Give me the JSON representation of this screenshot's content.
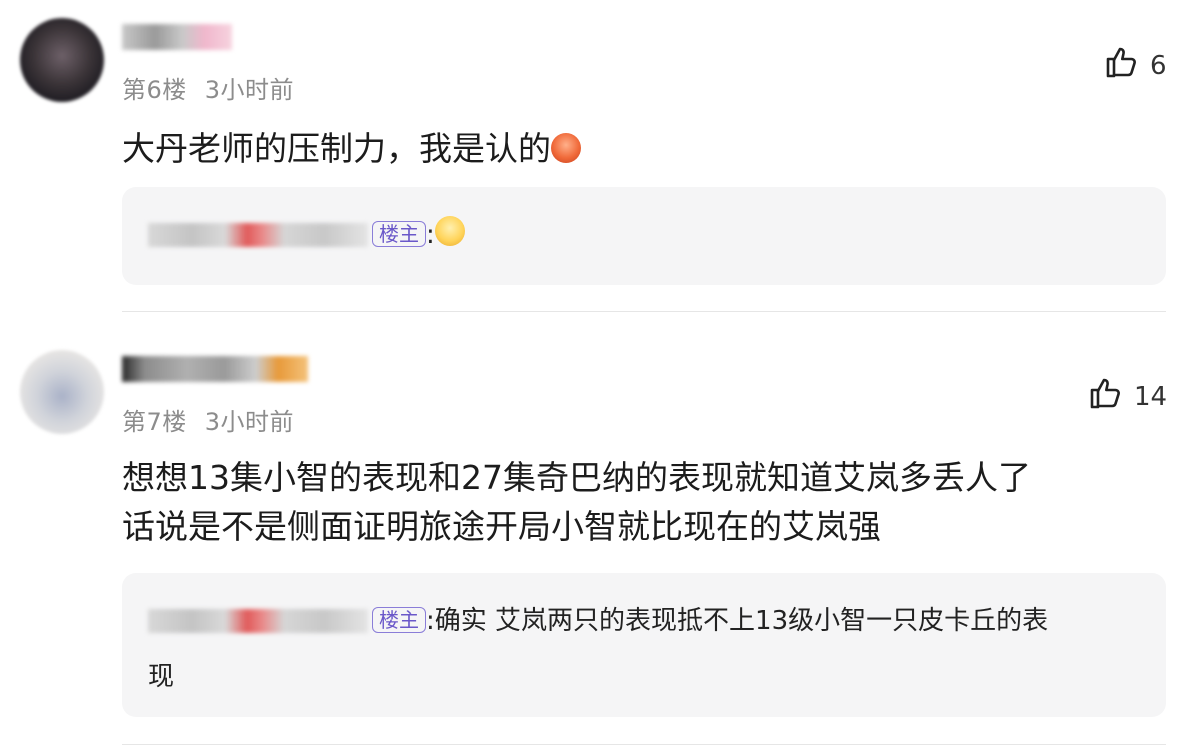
{
  "comments": [
    {
      "floor": "第6楼",
      "time": "3小时前",
      "likes": "6",
      "text": "大丹老师的压制力，我是认的",
      "emoji": "angry-face-emoji",
      "reply": {
        "host_badge": "楼主",
        "separator": ":",
        "text": "",
        "emoji": "smile-face-emoji"
      }
    },
    {
      "floor": "第7楼",
      "time": "3小时前",
      "likes": "14",
      "text_line1": "想想13集小智的表现和27集奇巴纳的表现就知道艾岚多丢人了",
      "text_line2": "话说是不是侧面证明旅途开局小智就比现在的艾岚强",
      "reply": {
        "host_badge": "楼主",
        "separator": ":",
        "text_line1": "确实 艾岚两只的表现抵不上13级小智一只皮卡丘的表",
        "text_line2": "现"
      }
    }
  ],
  "icons": {
    "like": "thumbs-up-icon"
  }
}
